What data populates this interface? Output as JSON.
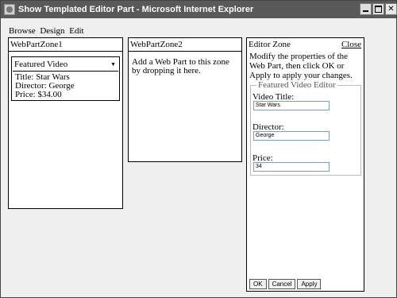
{
  "window": {
    "title": "Show Templated Editor Part - Microsoft Internet Explorer"
  },
  "modes": {
    "browse": "Browse",
    "design": "Design",
    "edit": "Edit"
  },
  "zone1": {
    "title": "WebPartZone1",
    "part": {
      "title": "Featured Video",
      "menu_glyph": "▼",
      "title_line": "Title: Star Wars",
      "director_line": "Director: George",
      "price_line": "Price: $34.00"
    }
  },
  "zone2": {
    "title": "WebPartZone2",
    "message": "Add a Web Part to this zone by dropping it here."
  },
  "editor_zone": {
    "title": "Editor Zone",
    "close_label": "Close",
    "instructions": "Modify the properties of the Web Part, then click OK or Apply to apply your changes.",
    "editor": {
      "legend": "Featured Video Editor",
      "video_title_label": "Video Title:",
      "video_title_value": "Star Wars",
      "director_label": "Director:",
      "director_value": "George",
      "price_label": "Price:",
      "price_value": "34"
    },
    "buttons": {
      "ok": "OK",
      "cancel": "Cancel",
      "apply": "Apply"
    }
  },
  "colors": {
    "titlebar": "#595959",
    "background": "#efefef",
    "input_border": "#7f9db9"
  }
}
